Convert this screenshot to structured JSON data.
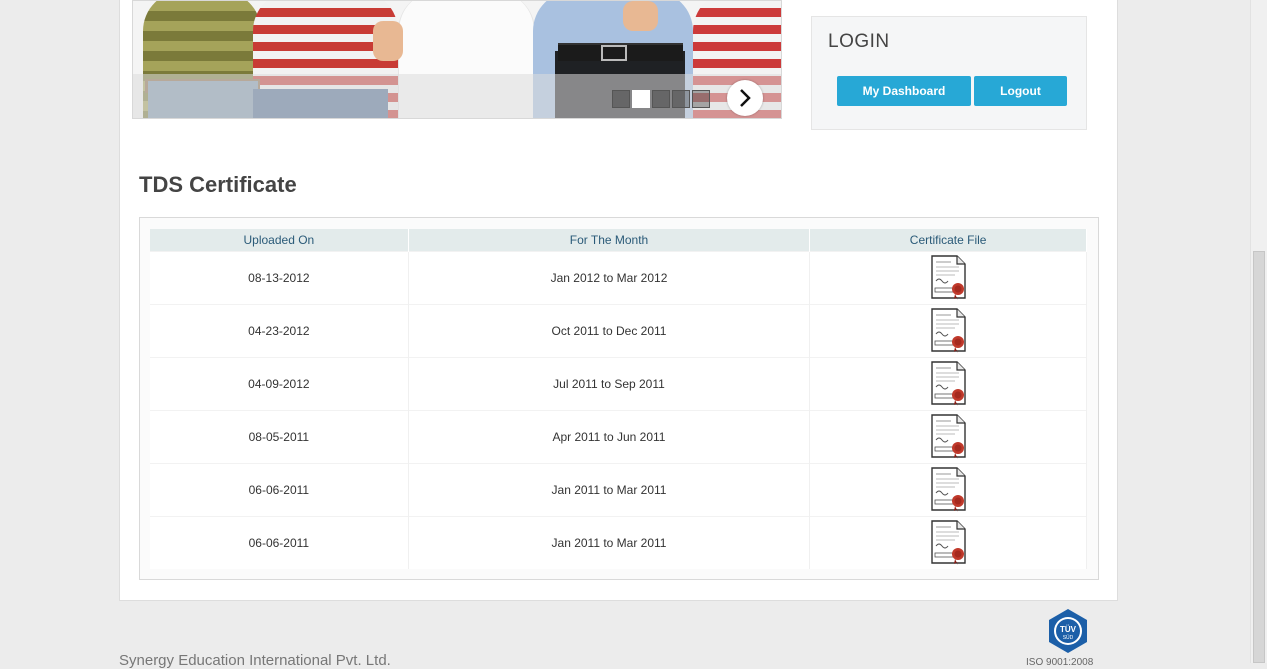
{
  "slider": {
    "slide_count": 5,
    "active_slide": 2,
    "next_icon": "chevron-right-icon"
  },
  "login": {
    "title": "LOGIN",
    "dashboard_label": "My Dashboard",
    "logout_label": "Logout",
    "accent_color": "#27a8d6"
  },
  "tds": {
    "title": "TDS Certificate",
    "headers": [
      "Uploaded On",
      "For The Month",
      "Certificate File"
    ],
    "rows": [
      {
        "uploaded": "08-13-2012",
        "period": "Jan 2012 to Mar 2012",
        "file_icon": "certificate-icon"
      },
      {
        "uploaded": "04-23-2012",
        "period": "Oct 2011 to Dec 2011",
        "file_icon": "certificate-icon"
      },
      {
        "uploaded": "04-09-2012",
        "period": "Jul 2011 to Sep 2011",
        "file_icon": "certificate-icon"
      },
      {
        "uploaded": "08-05-2011",
        "period": "Apr 2011 to Jun 2011",
        "file_icon": "certificate-icon"
      },
      {
        "uploaded": "06-06-2011",
        "period": "Jan 2011 to Mar 2011",
        "file_icon": "certificate-icon"
      },
      {
        "uploaded": "06-06-2011",
        "period": "Jan 2011 to Mar 2011",
        "file_icon": "certificate-icon"
      }
    ]
  },
  "footer": {
    "company": "Synergy Education International Pvt. Ltd.",
    "cert_mark_text": "TÜV",
    "cert_mark_subtext": "SÜD",
    "iso_text": "ISO 9001:2008"
  }
}
